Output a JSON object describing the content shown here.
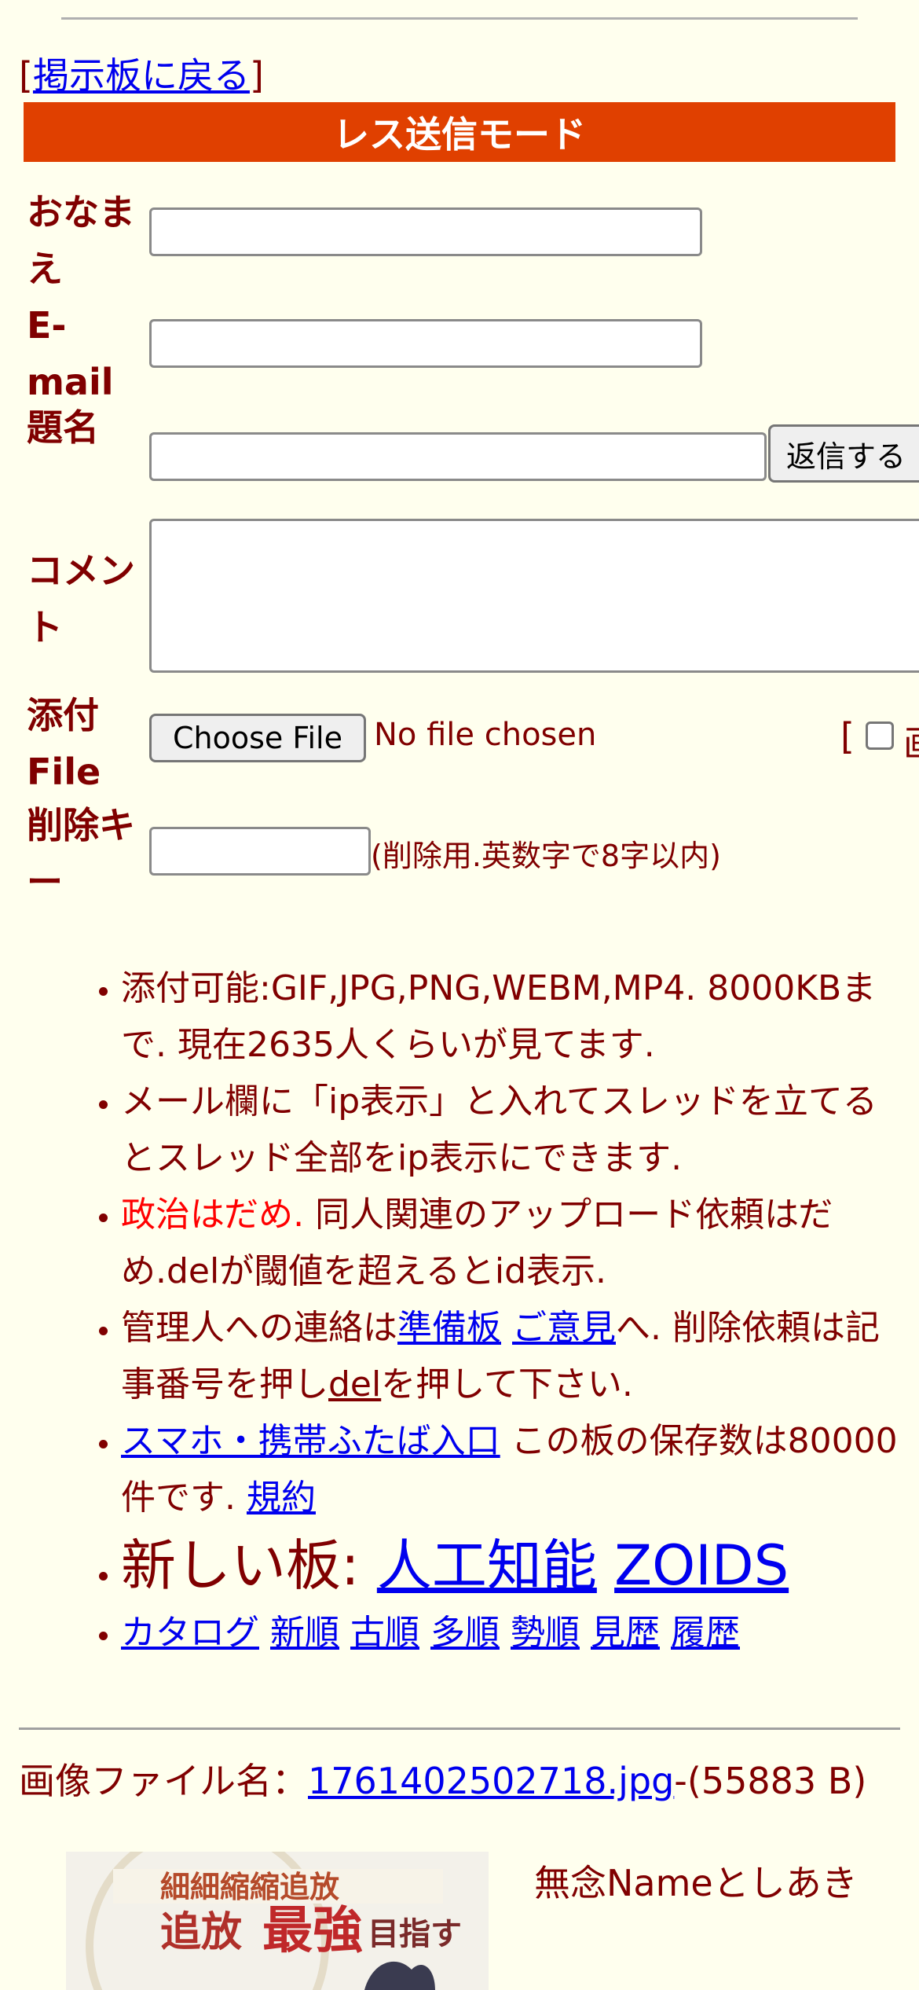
{
  "nav": {
    "back_open": "[",
    "back_link": "掲示板に戻る",
    "back_close": "]"
  },
  "form": {
    "mode_title": "レス送信モード",
    "name_label": "おなまえ",
    "email_label": "E-mail",
    "subject_label": "題名",
    "comment_label": "コメント",
    "attach_label": "添付File",
    "delkey_label": "削除キー",
    "submit_label": "返信する",
    "choose_file_label": "Choose File",
    "no_file_text": "No file chosen",
    "bracket_open": "[",
    "cut_text": "画",
    "delkey_note": "(削除用.英数字で8字以内)"
  },
  "notes": {
    "n1": "添付可能:GIF,JPG,PNG,WEBM,MP4. 8000KBまで. 現在2635人くらいが見てます.",
    "n2": "メール欄に「ip表示」と入れてスレッドを立てるとスレッド全部をip表示にできます.",
    "n3_red": "政治はだめ.",
    "n3_rest": " 同人関連のアップロード依頼はだめ.delが閾値を超えるとid表示.",
    "n4_a": "管理人への連絡は",
    "n4_link1": "準備板",
    "n4_link2": "ご意見",
    "n4_b": "へ. 削除依頼は記事番号を押し",
    "n4_link3": "del",
    "n4_c": "を押して下さい.",
    "n5_link": "スマホ・携帯ふたば入口",
    "n5_text": " この板の保存数は80000件です. ",
    "n5_link2": "規約",
    "n6_text": "新しい板: ",
    "n6_link1": "人工知能",
    "n6_link2": "ZOIDS",
    "n7_links": [
      "カタログ",
      "新順",
      "古順",
      "多順",
      "勢順",
      "見歴",
      "履歴"
    ]
  },
  "post": {
    "file_label": "画像ファイル名：",
    "file_link": "1761402502718.jpg",
    "file_size": "-(55883 B)",
    "thumb_text1": "追放",
    "thumb_text2": "最強",
    "thumb_text3": "目指す",
    "name_text": "無念Nameとしあき"
  },
  "colors": {
    "background": "#ffffee",
    "text": "#800000",
    "accent_bar": "#e04000",
    "link": "#0000ee",
    "warning": "#ff0000"
  }
}
